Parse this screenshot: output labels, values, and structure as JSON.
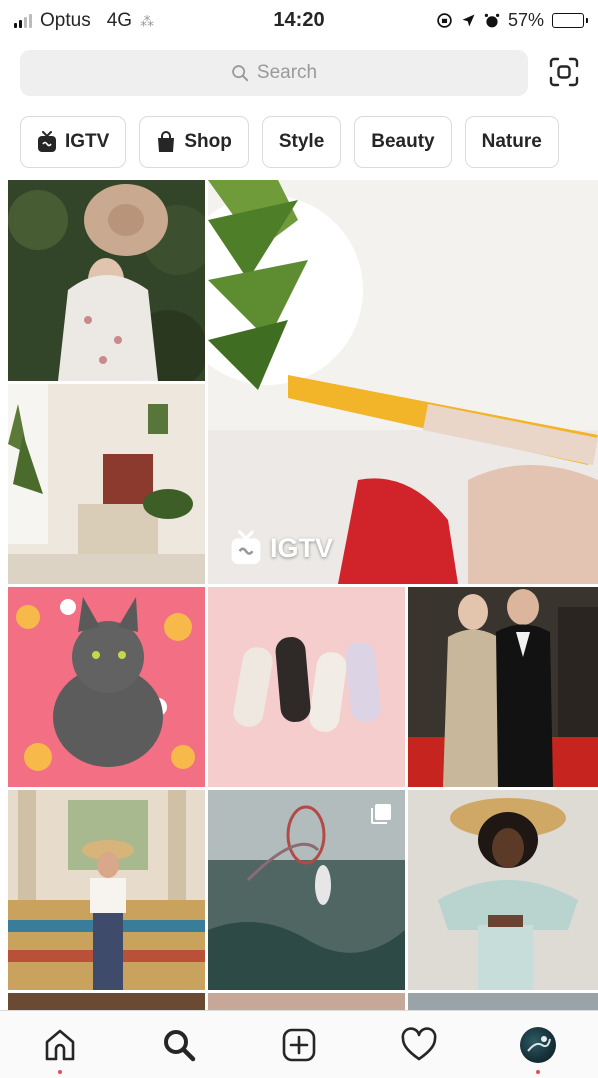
{
  "status_bar": {
    "carrier": "Optus",
    "network": "4G",
    "time": "14:20",
    "battery_percent": "57%",
    "battery_level": 0.57
  },
  "search": {
    "placeholder": "Search",
    "icon": "search-icon"
  },
  "scan": {
    "icon": "scan-icon"
  },
  "categories": [
    {
      "label": "IGTV",
      "icon": "igtv-icon"
    },
    {
      "label": "Shop",
      "icon": "shopping-bag-icon"
    },
    {
      "label": "Style"
    },
    {
      "label": "Beauty"
    },
    {
      "label": "Nature"
    }
  ],
  "grid": {
    "featured_badge": "IGTV",
    "tiles": [
      {
        "subject": "woman in floral dress with hat",
        "colors": [
          "#2f3f25",
          "#e8e1da"
        ]
      },
      {
        "subject": "plant and highlighter pen",
        "colors": [
          "#f3f1ee",
          "#e9b43c"
        ]
      },
      {
        "subject": "boho living room",
        "colors": [
          "#e7e0d6",
          "#8c3a2e"
        ]
      },
      {
        "subject": "grey cat on floral blanket",
        "colors": [
          "#f26f84",
          "#5e5e5e"
        ]
      },
      {
        "subject": "sneakers on pink",
        "colors": [
          "#f6cdcd",
          "#d9d2c9"
        ]
      },
      {
        "subject": "red carpet couple",
        "colors": [
          "#2b2622",
          "#c6241f"
        ]
      },
      {
        "subject": "woman on tiled bench",
        "colors": [
          "#d8c8a8",
          "#c9a35e"
        ]
      },
      {
        "subject": "surfer with hoop in sea",
        "colors": [
          "#a9b2b3",
          "#2e4a47"
        ]
      },
      {
        "subject": "woman in straw hat",
        "colors": [
          "#d9d6d0",
          "#b9d3cf"
        ]
      }
    ]
  },
  "tab_bar": {
    "items": [
      {
        "name": "home",
        "icon": "home-icon"
      },
      {
        "name": "search",
        "icon": "search-icon",
        "active": true
      },
      {
        "name": "new-post",
        "icon": "plus-square-icon"
      },
      {
        "name": "activity",
        "icon": "heart-icon"
      },
      {
        "name": "profile",
        "icon": "avatar"
      }
    ],
    "notification_color": "#ed4956"
  }
}
